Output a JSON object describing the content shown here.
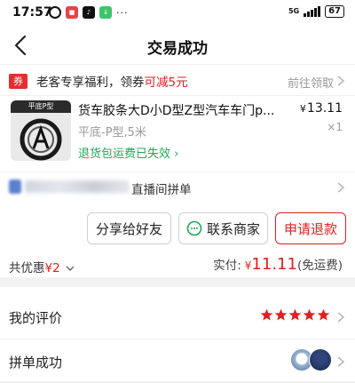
{
  "status_bar": {
    "time": "17:57",
    "app_icons": [
      "alarm-icon",
      "app-icon-red",
      "tiktok-icon",
      "download-icon"
    ],
    "more": "···",
    "network": "5G",
    "battery": "67"
  },
  "nav": {
    "title": "交易成功",
    "back_icon": "chevron-left-icon"
  },
  "coupon": {
    "tag": "券",
    "text": "老客专享福利，领券",
    "highlight": "可减5元",
    "action": "前往领取"
  },
  "product": {
    "thumb_label": "平底P型",
    "title": "货车胶条大D小D型Z型汽车车门p...",
    "price_symbol": "¥",
    "price": "13.11",
    "spec": "平底-P型,5米",
    "quantity": "×1",
    "return_notice": "退货包运费已失效"
  },
  "group": {
    "text": "直播间拼单"
  },
  "actions": {
    "share": "分享给好友",
    "contact": "联系商家",
    "refund": "申请退款"
  },
  "totals": {
    "discount_label": "共优惠",
    "discount_value": "¥2",
    "paid_label": "实付:",
    "paid_currency": "¥",
    "paid_amount": "11.11",
    "shipping": "(免运费)"
  },
  "review": {
    "label": "我的评价",
    "stars": 5
  },
  "group_success": {
    "label": "拼单成功"
  },
  "colors": {
    "accent_red": "#e02020",
    "coupon_red": "#e52e2e",
    "success_green": "#1fa854"
  }
}
